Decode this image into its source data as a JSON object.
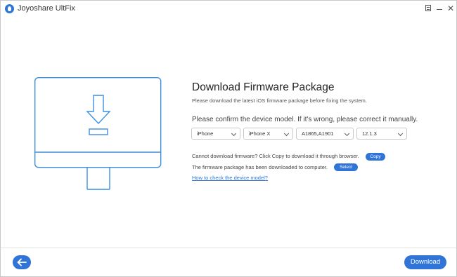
{
  "window": {
    "title": "Joyoshare UltFix",
    "controls": [
      "menu-icon",
      "minimize-icon",
      "close-icon"
    ],
    "close_glyph": "✕"
  },
  "main": {
    "heading": "Download Firmware Package",
    "subtitle": "Please download the latest iOS firmware package before fixing the system.",
    "confirm_text": "Please confirm the device model. If it's wrong, please correct it manually.",
    "selects": [
      {
        "value": "iPhone"
      },
      {
        "value": "iPhone X"
      },
      {
        "value": "A1865,A1901"
      },
      {
        "value": "12.1.3"
      }
    ],
    "copy_note": "Cannot download firmware? Click Copy to download it through browser.",
    "copy_button": "Copy",
    "select_note": "The firmware package has been downloaded to computer.",
    "select_button": "Select",
    "help_link": "How to check the device model?"
  },
  "footer": {
    "back_icon": "arrow-left-icon",
    "download_button": "Download"
  },
  "colors": {
    "accent": "#2f74d6",
    "illustration": "#3d8fe0"
  }
}
